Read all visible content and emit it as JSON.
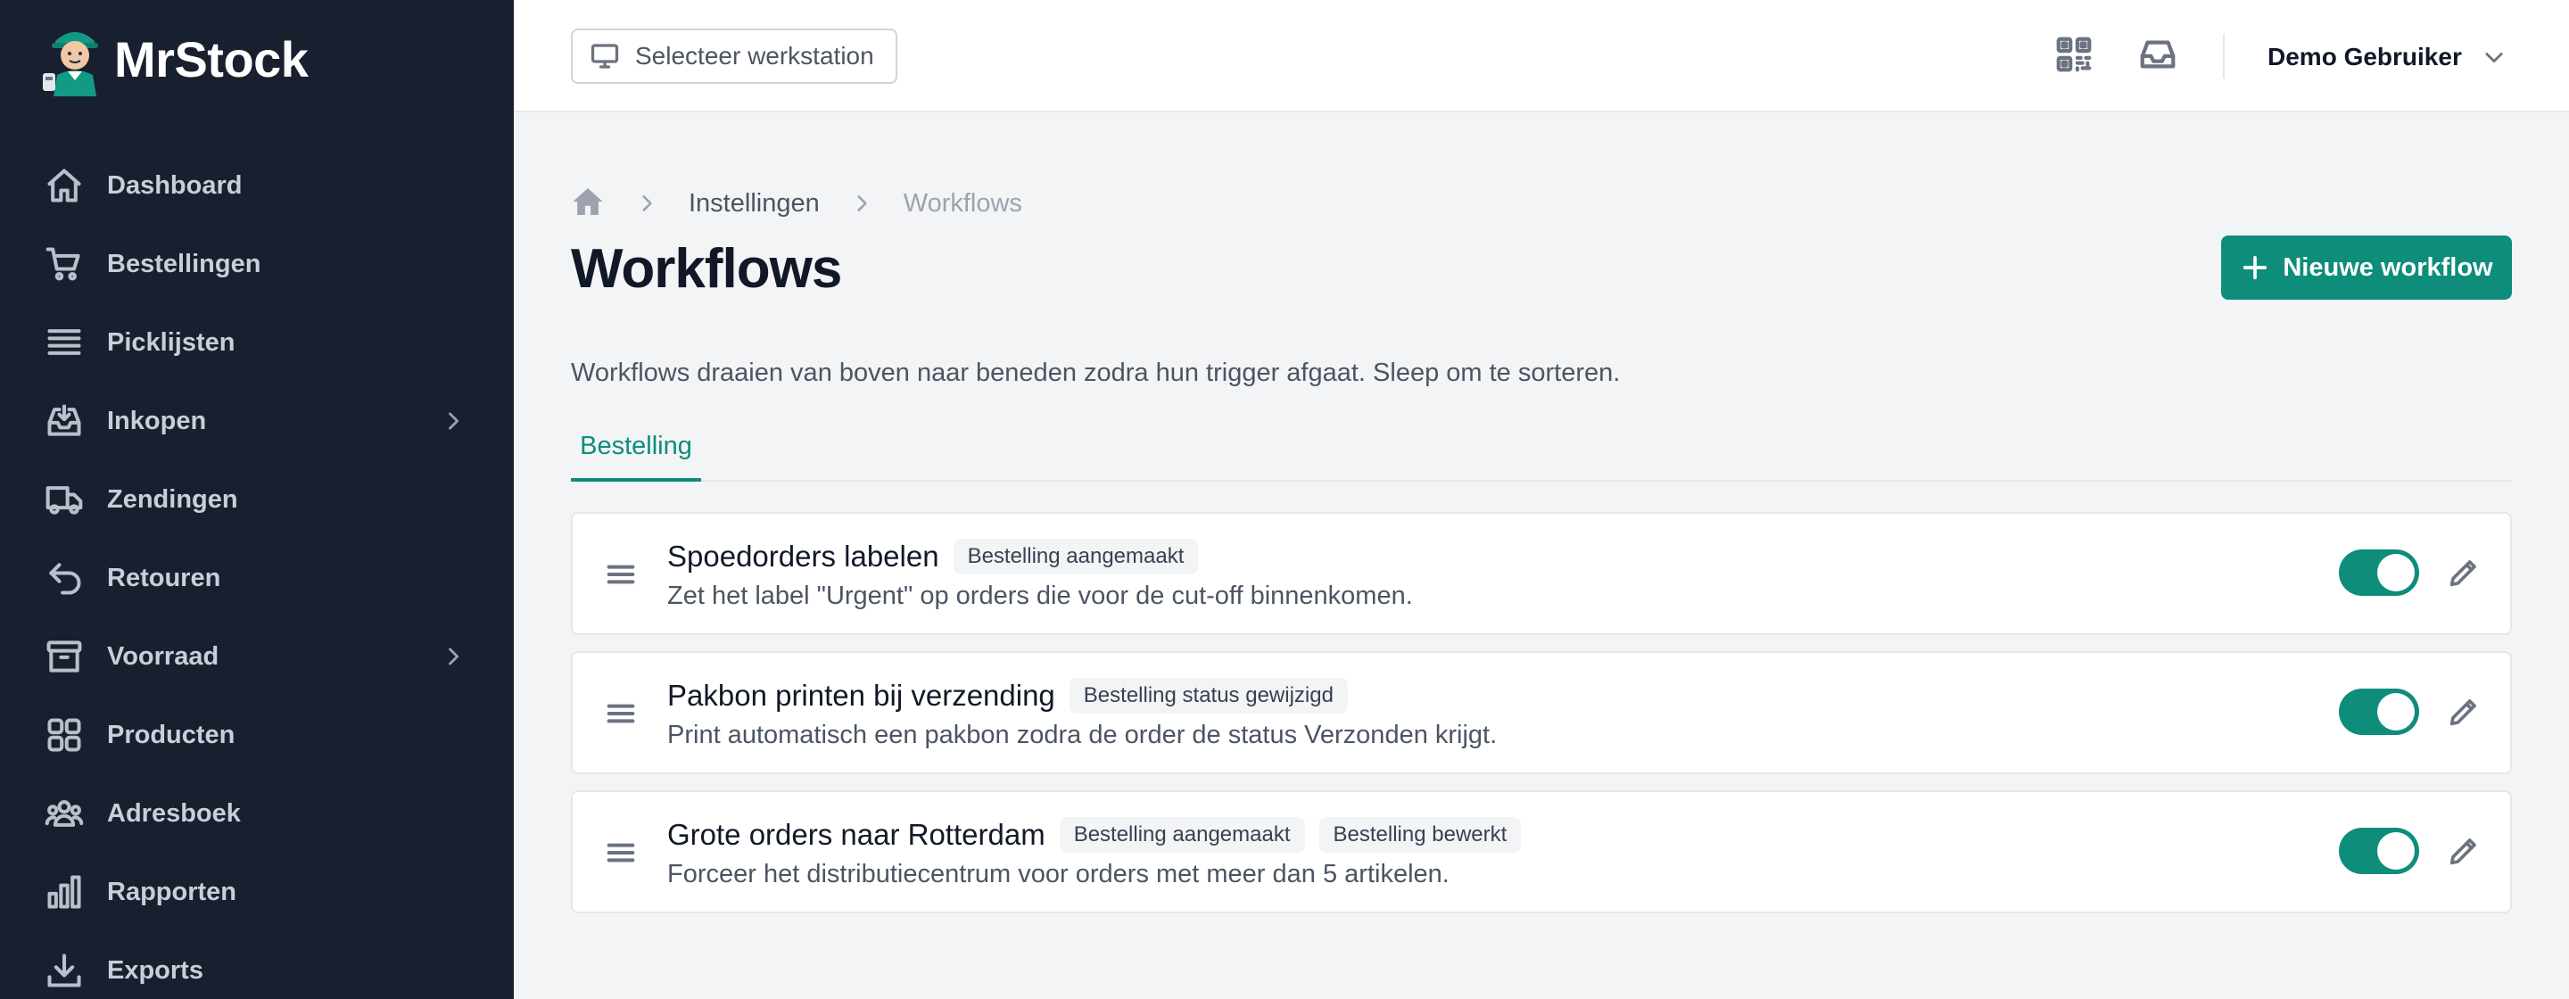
{
  "app": {
    "name": "MrStock"
  },
  "sidebar": {
    "items": [
      {
        "label": "Dashboard",
        "icon": "home-icon",
        "has_children": false
      },
      {
        "label": "Bestellingen",
        "icon": "cart-icon",
        "has_children": false
      },
      {
        "label": "Picklijsten",
        "icon": "list-icon",
        "has_children": false
      },
      {
        "label": "Inkopen",
        "icon": "inbox-download-icon",
        "has_children": true
      },
      {
        "label": "Zendingen",
        "icon": "truck-icon",
        "has_children": false
      },
      {
        "label": "Retouren",
        "icon": "return-arrow-icon",
        "has_children": false
      },
      {
        "label": "Voorraad",
        "icon": "archive-box-icon",
        "has_children": true
      },
      {
        "label": "Producten",
        "icon": "grid-icon",
        "has_children": false
      },
      {
        "label": "Adresboek",
        "icon": "users-icon",
        "has_children": false
      },
      {
        "label": "Rapporten",
        "icon": "bar-chart-icon",
        "has_children": false
      },
      {
        "label": "Exports",
        "icon": "download-icon",
        "has_children": false
      }
    ]
  },
  "topbar": {
    "workstation_label": "Selecteer werkstation",
    "user_name": "Demo Gebruiker"
  },
  "breadcrumb": {
    "items": [
      "Instellingen",
      "Workflows"
    ]
  },
  "page": {
    "title": "Workflows",
    "new_button_label": "Nieuwe workflow",
    "description": "Workflows draaien van boven naar beneden zodra hun trigger afgaat. Sleep om te sorteren."
  },
  "tabs": [
    {
      "label": "Bestelling",
      "active": true
    }
  ],
  "workflows": [
    {
      "title": "Spoedorders labelen",
      "badges": [
        "Bestelling aangemaakt"
      ],
      "description": "Zet het label \"Urgent\" op orders die voor de cut-off binnenkomen.",
      "enabled": true
    },
    {
      "title": "Pakbon printen bij verzending",
      "badges": [
        "Bestelling status gewijzigd"
      ],
      "description": "Print automatisch een pakbon zodra de order de status Verzonden krijgt.",
      "enabled": true
    },
    {
      "title": "Grote orders naar Rotterdam",
      "badges": [
        "Bestelling aangemaakt",
        "Bestelling bewerkt"
      ],
      "description": "Forceer het distributiecentrum voor orders met meer dan 5 artikelen.",
      "enabled": true
    }
  ],
  "colors": {
    "sidebar_bg": "#18202f",
    "accent": "#0d8d7a",
    "page_bg": "#f3f4f6"
  }
}
